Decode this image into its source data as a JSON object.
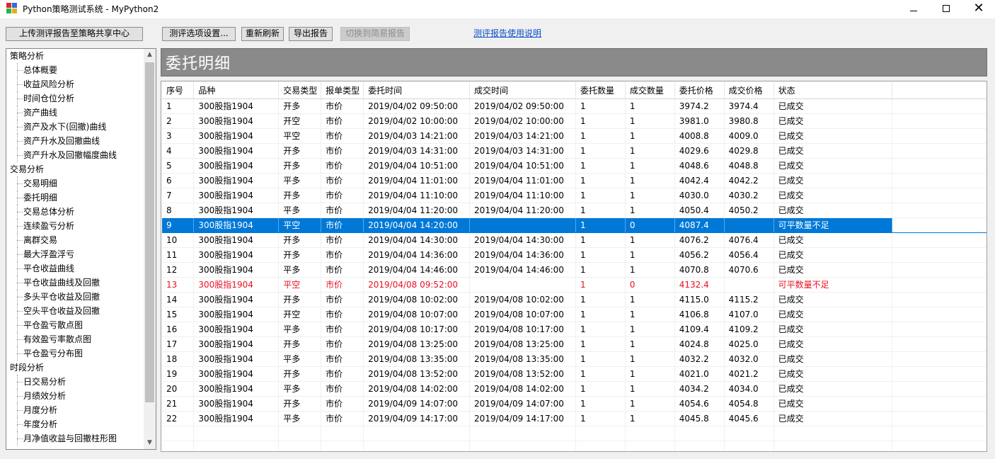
{
  "window": {
    "title": "Python策略测试系统 - MyPython2",
    "controls": {
      "minimize": "—",
      "close": "✕"
    }
  },
  "toolbar": {
    "upload": "上传测评报告至策略共享中心",
    "options": "测评选项设置...",
    "refresh": "重新刷新",
    "export": "导出报告",
    "switch": "切换到简易报告",
    "help_link": "测评报告使用说明"
  },
  "tree": {
    "groups": [
      {
        "label": "策略分析",
        "items": [
          "总体概要",
          "收益风险分析",
          "时间仓位分析",
          "资产曲线",
          "资产及水下(回撤)曲线",
          "资产升水及回撤曲线",
          "资产升水及回撤幅度曲线"
        ]
      },
      {
        "label": "交易分析",
        "items": [
          "交易明细",
          "委托明细",
          "交易总体分析",
          "连续盈亏分析",
          "离群交易",
          "最大浮盈浮亏",
          "平仓收益曲线",
          "平仓收益曲线及回撤",
          "多头平仓收益及回撤",
          "空头平仓收益及回撤",
          "平仓盈亏散点图",
          "有效盈亏率散点图",
          "平仓盈亏分布图"
        ]
      },
      {
        "label": "时段分析",
        "items": [
          "日交易分析",
          "月绩效分析",
          "月度分析",
          "年度分析",
          "月净值收益与回撤柱形图"
        ]
      }
    ]
  },
  "panel": {
    "title": "委托明细"
  },
  "table": {
    "columns": [
      "序号",
      "品种",
      "交易类型",
      "报单类型",
      "委托时间",
      "成交时间",
      "委托数量",
      "成交数量",
      "委托价格",
      "成交价格",
      "状态"
    ],
    "selected_row": 9,
    "warn_rows": [
      13
    ],
    "rows": [
      [
        "1",
        "300股指1904",
        "开多",
        "市价",
        "2019/04/02 09:50:00",
        "2019/04/02 09:50:00",
        "1",
        "1",
        "3974.2",
        "3974.4",
        "已成交"
      ],
      [
        "2",
        "300股指1904",
        "开空",
        "市价",
        "2019/04/02 10:00:00",
        "2019/04/02 10:00:00",
        "1",
        "1",
        "3981.0",
        "3980.8",
        "已成交"
      ],
      [
        "3",
        "300股指1904",
        "平空",
        "市价",
        "2019/04/03 14:21:00",
        "2019/04/03 14:21:00",
        "1",
        "1",
        "4008.8",
        "4009.0",
        "已成交"
      ],
      [
        "4",
        "300股指1904",
        "开多",
        "市价",
        "2019/04/03 14:31:00",
        "2019/04/03 14:31:00",
        "1",
        "1",
        "4029.6",
        "4029.8",
        "已成交"
      ],
      [
        "5",
        "300股指1904",
        "开多",
        "市价",
        "2019/04/04 10:51:00",
        "2019/04/04 10:51:00",
        "1",
        "1",
        "4048.6",
        "4048.8",
        "已成交"
      ],
      [
        "6",
        "300股指1904",
        "平多",
        "市价",
        "2019/04/04 11:01:00",
        "2019/04/04 11:01:00",
        "1",
        "1",
        "4042.4",
        "4042.2",
        "已成交"
      ],
      [
        "7",
        "300股指1904",
        "开多",
        "市价",
        "2019/04/04 11:10:00",
        "2019/04/04 11:10:00",
        "1",
        "1",
        "4030.0",
        "4030.2",
        "已成交"
      ],
      [
        "8",
        "300股指1904",
        "平多",
        "市价",
        "2019/04/04 11:20:00",
        "2019/04/04 11:20:00",
        "1",
        "1",
        "4050.4",
        "4050.2",
        "已成交"
      ],
      [
        "9",
        "300股指1904",
        "平空",
        "市价",
        "2019/04/04 14:20:00",
        "",
        "1",
        "0",
        "4087.4",
        "",
        "可平数量不足"
      ],
      [
        "10",
        "300股指1904",
        "开多",
        "市价",
        "2019/04/04 14:30:00",
        "2019/04/04 14:30:00",
        "1",
        "1",
        "4076.2",
        "4076.4",
        "已成交"
      ],
      [
        "11",
        "300股指1904",
        "开多",
        "市价",
        "2019/04/04 14:36:00",
        "2019/04/04 14:36:00",
        "1",
        "1",
        "4056.2",
        "4056.4",
        "已成交"
      ],
      [
        "12",
        "300股指1904",
        "平多",
        "市价",
        "2019/04/04 14:46:00",
        "2019/04/04 14:46:00",
        "1",
        "1",
        "4070.8",
        "4070.6",
        "已成交"
      ],
      [
        "13",
        "300股指1904",
        "平空",
        "市价",
        "2019/04/08 09:52:00",
        "",
        "1",
        "0",
        "4132.4",
        "",
        "可平数量不足"
      ],
      [
        "14",
        "300股指1904",
        "开多",
        "市价",
        "2019/04/08 10:02:00",
        "2019/04/08 10:02:00",
        "1",
        "1",
        "4115.0",
        "4115.2",
        "已成交"
      ],
      [
        "15",
        "300股指1904",
        "开空",
        "市价",
        "2019/04/08 10:07:00",
        "2019/04/08 10:07:00",
        "1",
        "1",
        "4106.8",
        "4107.0",
        "已成交"
      ],
      [
        "16",
        "300股指1904",
        "平多",
        "市价",
        "2019/04/08 10:17:00",
        "2019/04/08 10:17:00",
        "1",
        "1",
        "4109.4",
        "4109.2",
        "已成交"
      ],
      [
        "17",
        "300股指1904",
        "开多",
        "市价",
        "2019/04/08 13:25:00",
        "2019/04/08 13:25:00",
        "1",
        "1",
        "4024.8",
        "4025.0",
        "已成交"
      ],
      [
        "18",
        "300股指1904",
        "平多",
        "市价",
        "2019/04/08 13:35:00",
        "2019/04/08 13:35:00",
        "1",
        "1",
        "4032.2",
        "4032.0",
        "已成交"
      ],
      [
        "19",
        "300股指1904",
        "开多",
        "市价",
        "2019/04/08 13:52:00",
        "2019/04/08 13:52:00",
        "1",
        "1",
        "4021.0",
        "4021.2",
        "已成交"
      ],
      [
        "20",
        "300股指1904",
        "平多",
        "市价",
        "2019/04/08 14:02:00",
        "2019/04/08 14:02:00",
        "1",
        "1",
        "4034.2",
        "4034.0",
        "已成交"
      ],
      [
        "21",
        "300股指1904",
        "开多",
        "市价",
        "2019/04/09 14:07:00",
        "2019/04/09 14:07:00",
        "1",
        "1",
        "4054.6",
        "4054.8",
        "已成交"
      ],
      [
        "22",
        "300股指1904",
        "平多",
        "市价",
        "2019/04/09 14:17:00",
        "2019/04/09 14:17:00",
        "1",
        "1",
        "4045.8",
        "4045.6",
        "已成交"
      ]
    ]
  },
  "colors": {
    "selection": "#0078d7",
    "warning_text": "#e81123",
    "panel_header": "#8a8a8a",
    "link": "#0a4ec7"
  }
}
